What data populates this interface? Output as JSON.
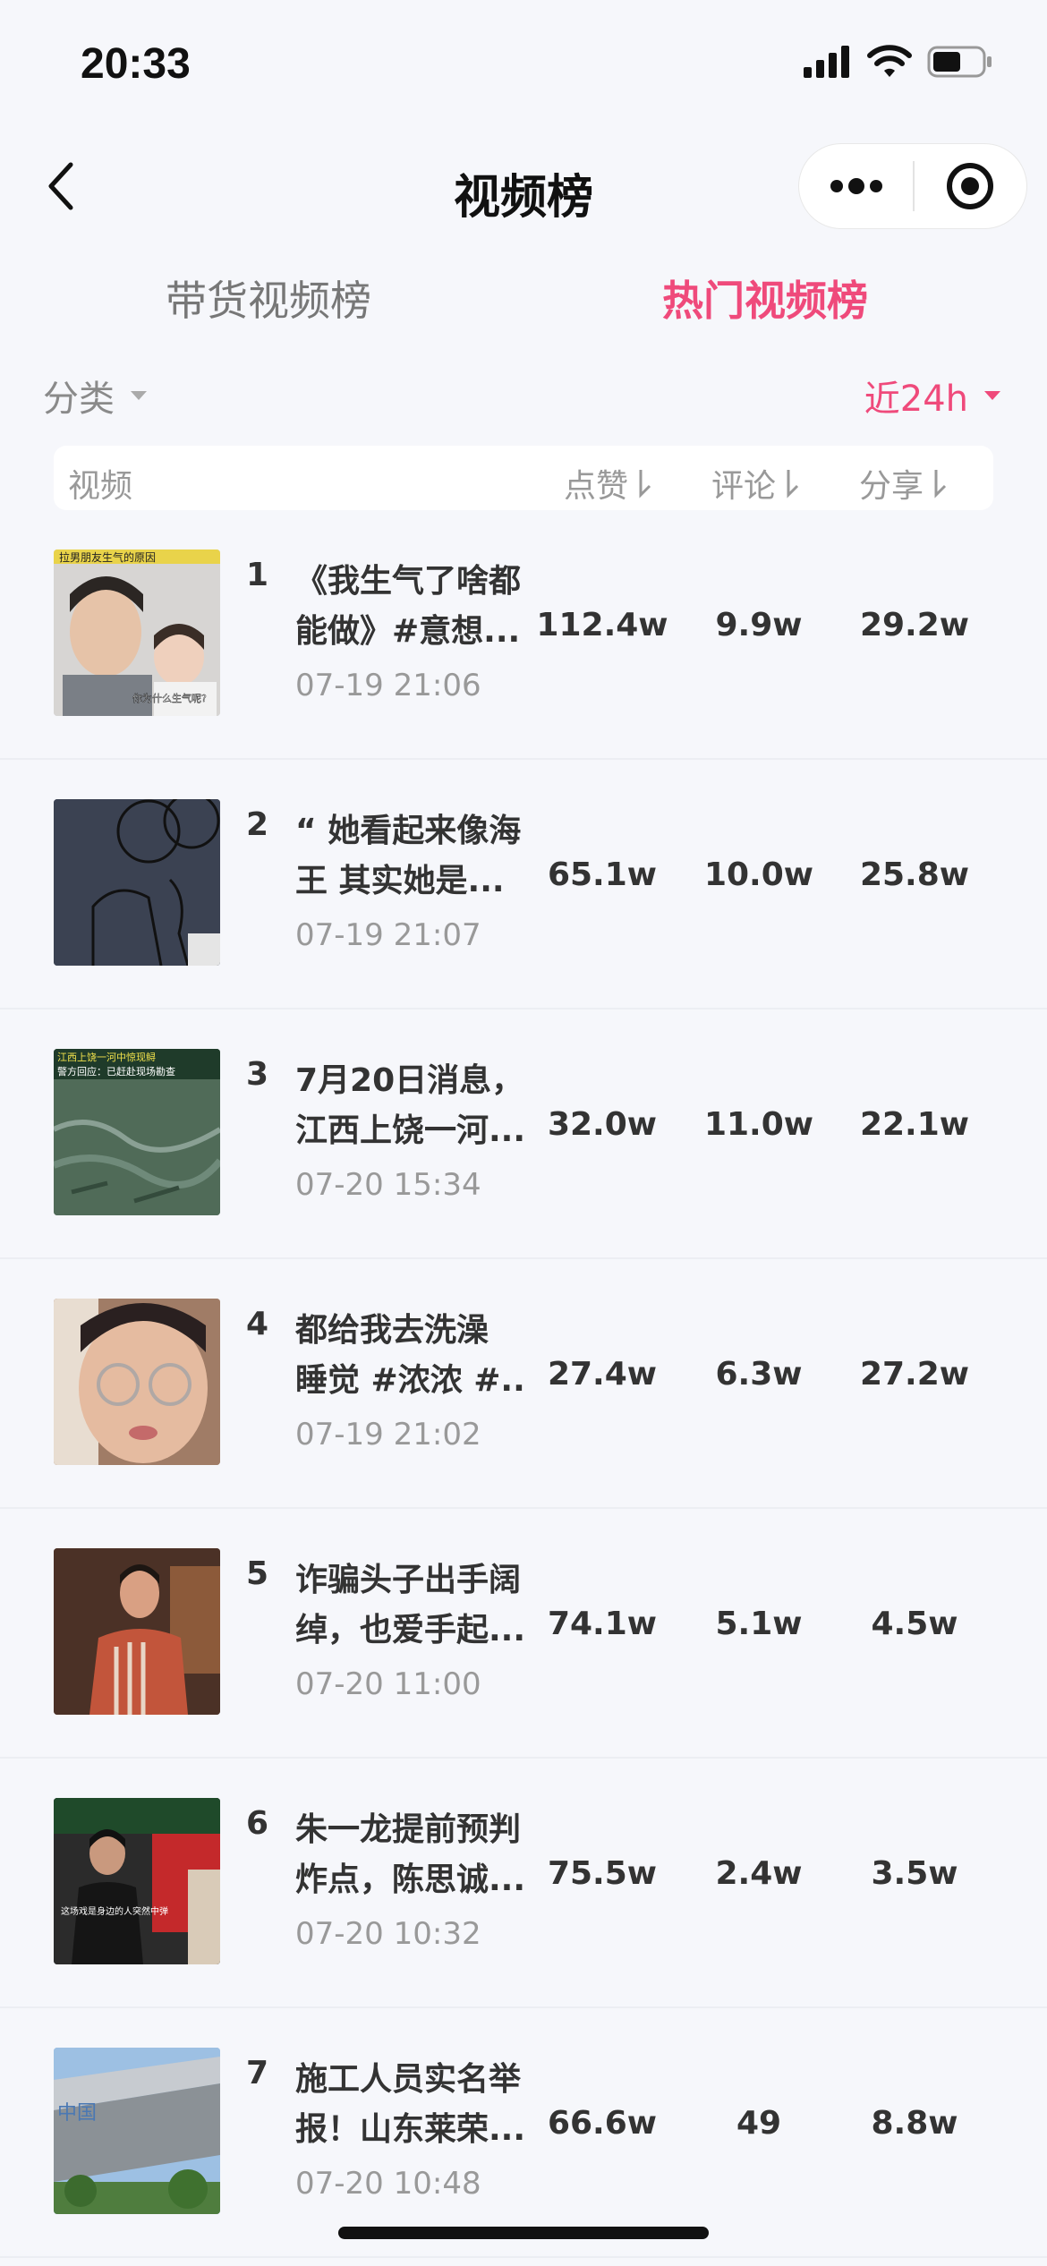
{
  "status_bar": {
    "time": "20:33"
  },
  "nav": {
    "title": "视频榜"
  },
  "tabs": [
    {
      "label": "带货视频榜",
      "active": false
    },
    {
      "label": "热门视频榜",
      "active": true
    }
  ],
  "filters": {
    "category": "分类",
    "time_range": "近24h"
  },
  "table": {
    "headers": {
      "video": "视频",
      "likes": "点赞",
      "comments": "评论",
      "shares": "分享"
    },
    "rows": [
      {
        "rank": "1",
        "title_line1": "《我生气了啥都",
        "title_line2": "能做》#意想...",
        "time": "07-19 21:06",
        "likes": "112.4w",
        "comments": "9.9w",
        "shares": "29.2w"
      },
      {
        "rank": "2",
        "title_line1": "“ 她看起来像海",
        "title_line2": "王 其实她是...",
        "time": "07-19 21:07",
        "likes": "65.1w",
        "comments": "10.0w",
        "shares": "25.8w"
      },
      {
        "rank": "3",
        "title_line1": "7月20日消息，",
        "title_line2": "江西上饶一河...",
        "time": "07-20 15:34",
        "likes": "32.0w",
        "comments": "11.0w",
        "shares": "22.1w"
      },
      {
        "rank": "4",
        "title_line1": "都给我去洗澡",
        "title_line2": "睡觉 #浓浓 #...",
        "time": "07-19 21:02",
        "likes": "27.4w",
        "comments": "6.3w",
        "shares": "27.2w"
      },
      {
        "rank": "5",
        "title_line1": "诈骗头子出手阔",
        "title_line2": "绰，也爱手起...",
        "time": "07-20 11:00",
        "likes": "74.1w",
        "comments": "5.1w",
        "shares": "4.5w"
      },
      {
        "rank": "6",
        "title_line1": "朱一龙提前预判",
        "title_line2": "炸点，陈思诚...",
        "time": "07-20 10:32",
        "likes": "75.5w",
        "comments": "2.4w",
        "shares": "3.5w"
      },
      {
        "rank": "7",
        "title_line1": "施工人员实名举",
        "title_line2": "报！山东莱荣...",
        "time": "07-20 10:48",
        "likes": "66.6w",
        "comments": "49",
        "shares": "8.8w"
      }
    ]
  },
  "thumbnails": [
    {
      "caption_top": "拉男朋友生气的原因",
      "caption_bottom": "你为什么生气呢?"
    },
    {
      "caption_top": "",
      "caption_bottom": ""
    },
    {
      "caption_top": "江西上饶一河中惊现鲟",
      "caption_bottom": "警方回应：已赶赴现场勘查"
    },
    {
      "caption_top": "",
      "caption_bottom": ""
    },
    {
      "caption_top": "",
      "caption_bottom": ""
    },
    {
      "caption_top": "",
      "caption_bottom": "这场戏是身边的人突然中弹"
    },
    {
      "caption_top": "",
      "caption_bottom": "中国"
    }
  ],
  "colors": {
    "accent": "#ef4a7b",
    "background": "#f6f7fb"
  }
}
